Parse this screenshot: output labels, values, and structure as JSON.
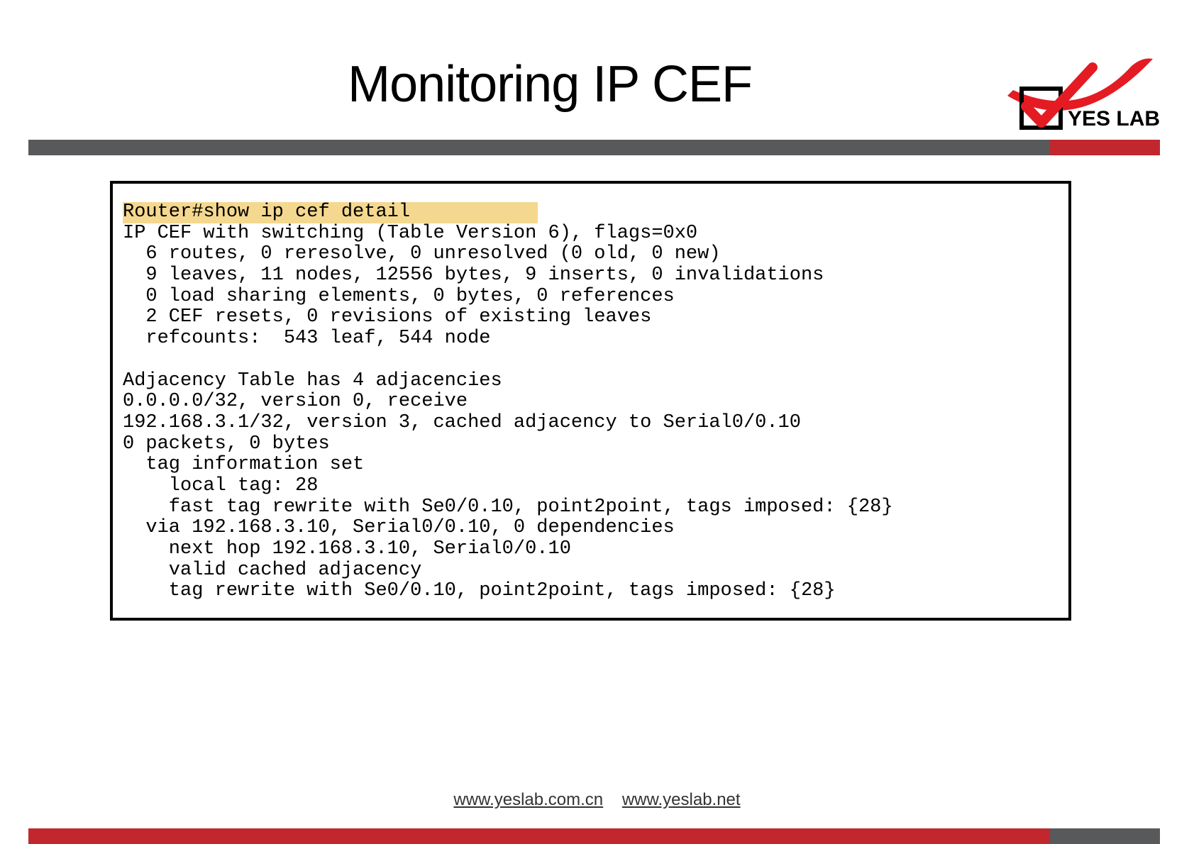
{
  "title": "Monitoring IP CEF",
  "logo_text": "YES LAB",
  "command": "Router#show ip cef detail",
  "output": "IP CEF with switching (Table Version 6), flags=0x0\n  6 routes, 0 reresolve, 0 unresolved (0 old, 0 new)\n  9 leaves, 11 nodes, 12556 bytes, 9 inserts, 0 invalidations\n  0 load sharing elements, 0 bytes, 0 references\n  2 CEF resets, 0 revisions of existing leaves\n  refcounts:  543 leaf, 544 node\n\nAdjacency Table has 4 adjacencies\n0.0.0.0/32, version 0, receive\n192.168.3.1/32, version 3, cached adjacency to Serial0/0.10\n0 packets, 0 bytes\n  tag information set\n    local tag: 28\n    fast tag rewrite with Se0/0.10, point2point, tags imposed: {28}\n  via 192.168.3.10, Serial0/0.10, 0 dependencies\n    next hop 192.168.3.10, Serial0/0.10\n    valid cached adjacency\n    tag rewrite with Se0/0.10, point2point, tags imposed: {28}",
  "footer": {
    "link1": "www.yeslab.com.cn",
    "link2": "www.yeslab.net"
  }
}
